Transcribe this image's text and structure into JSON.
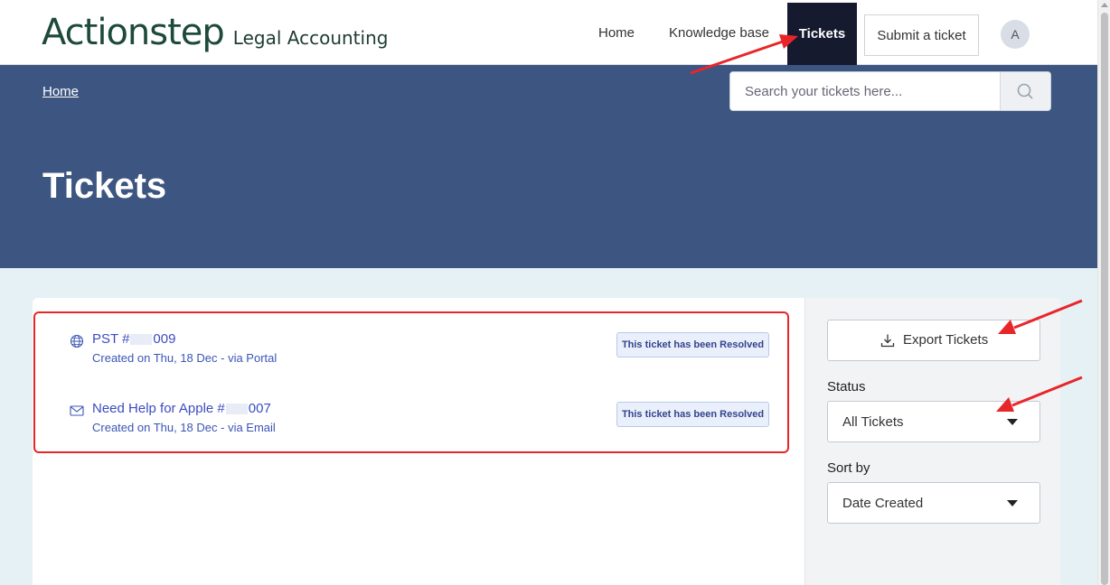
{
  "header": {
    "logo_text": "Actionstep",
    "subtitle": "Legal Accounting",
    "nav": {
      "home": "Home",
      "knowledge_base": "Knowledge base",
      "tickets": "Tickets",
      "submit_ticket": "Submit a ticket"
    },
    "avatar_initial": "A"
  },
  "hero": {
    "breadcrumb": "Home",
    "search_placeholder": "Search your tickets here...",
    "title": "Tickets"
  },
  "tickets": [
    {
      "title_prefix": "PST #",
      "title_suffix": "009",
      "meta": "Created on Thu, 18 Dec - via Portal",
      "status": "This ticket has been Resolved",
      "icon": "globe-icon"
    },
    {
      "title_prefix": "Need Help for Apple #",
      "title_suffix": "007",
      "meta": "Created on Thu, 18 Dec - via Email",
      "status": "This ticket has been Resolved",
      "icon": "mail-icon"
    }
  ],
  "sidebar": {
    "export_label": "Export Tickets",
    "status_label": "Status",
    "status_value": "All Tickets",
    "sort_label": "Sort by",
    "sort_value": "Date Created"
  },
  "colors": {
    "hero": "#3d5581",
    "active_tab": "#161a2e",
    "link": "#3b4cc0",
    "annotation": "#e8262a"
  }
}
